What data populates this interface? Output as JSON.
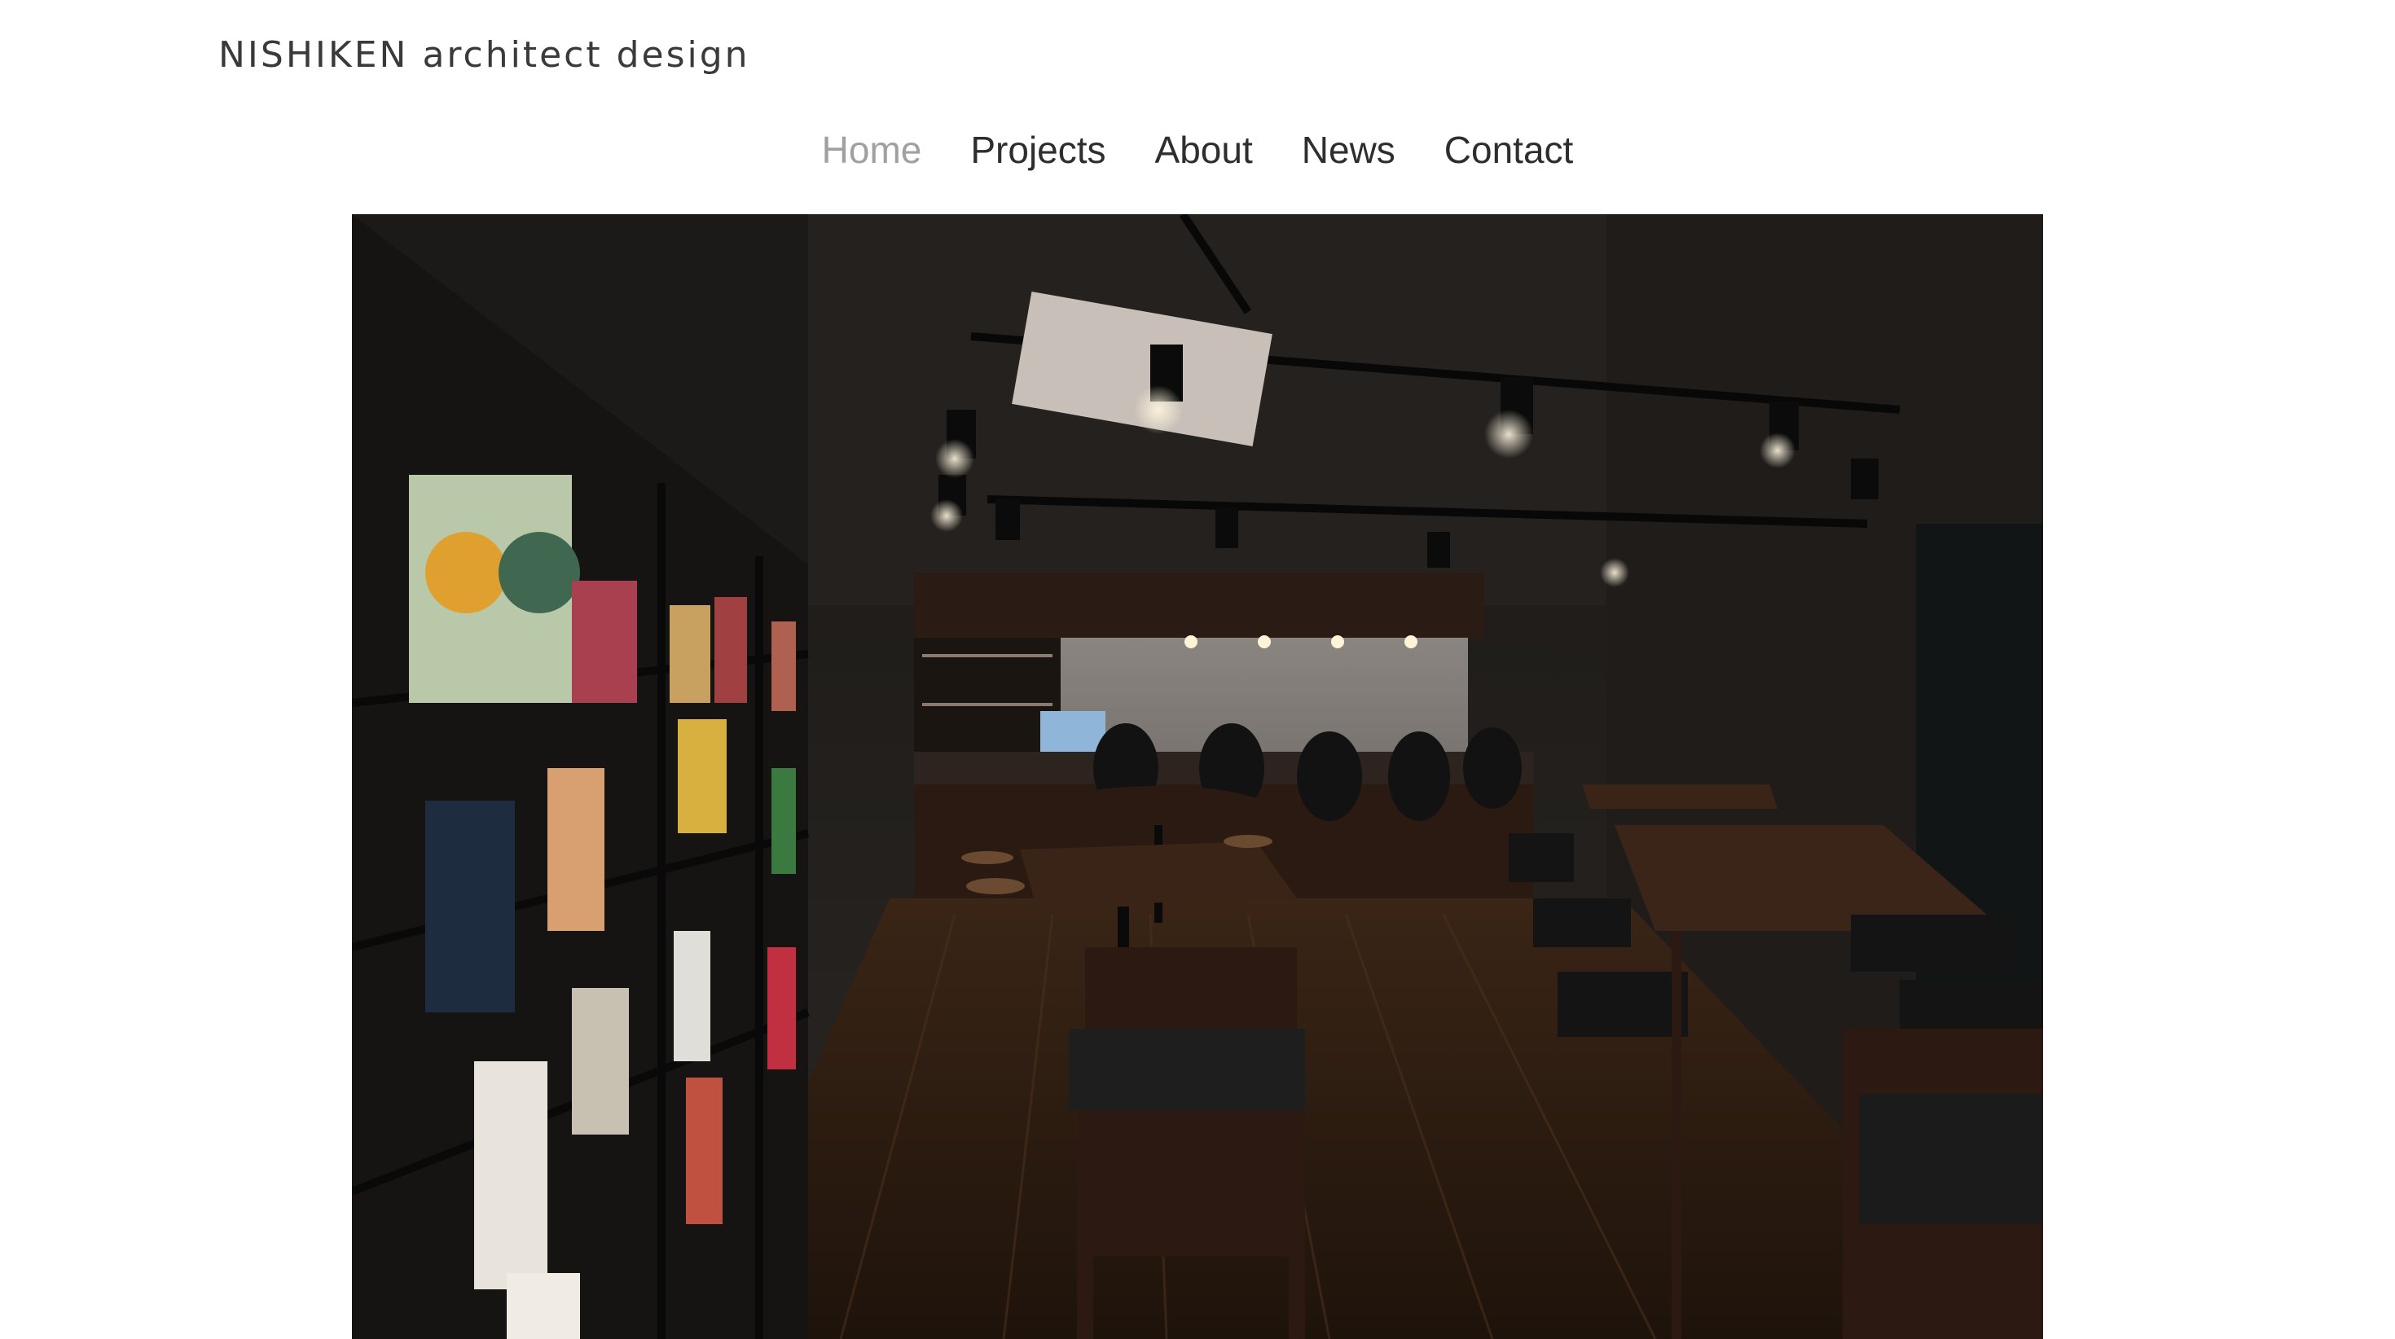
{
  "header": {
    "logo_text": "NISHIKEN architect design"
  },
  "nav": {
    "items": [
      {
        "label": "Home",
        "active": true
      },
      {
        "label": "Projects",
        "active": false
      },
      {
        "label": "About",
        "active": false
      },
      {
        "label": "News",
        "active": false
      },
      {
        "label": "Contact",
        "active": false
      }
    ]
  },
  "hero": {
    "image_name": "cafe-bar-interior-photo"
  },
  "colors": {
    "text": "#2e2e2e",
    "nav_active": "#a0a0a0",
    "background": "#ffffff"
  }
}
